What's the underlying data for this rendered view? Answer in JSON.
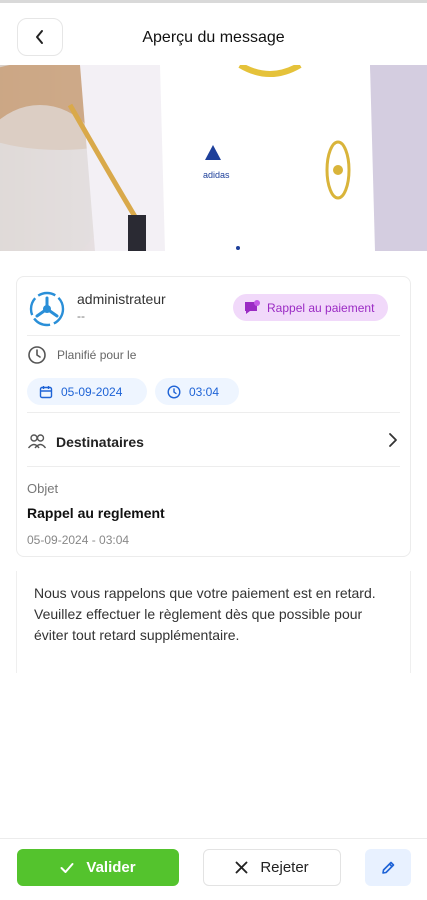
{
  "header": {
    "title": "Aperçu du message",
    "back_icon": "chevron-left-icon"
  },
  "hero": {
    "image_name": "sports-jersey-photo"
  },
  "sender": {
    "name": "administrateur",
    "sub": "--",
    "avatar_icon": "organization-logo-icon"
  },
  "badge": {
    "label": "Rappel au paiement",
    "icon": "chat-money-icon",
    "color": "#9b2bc4",
    "bg": "#f1d9fa"
  },
  "schedule": {
    "label": "Planifié pour le",
    "date": "05-09-2024",
    "time": "03:04",
    "chip_color": "#1e63d6"
  },
  "recipients": {
    "label": "Destinataires"
  },
  "subject": {
    "label": "Objet",
    "value": "Rappel au reglement",
    "datetime": "05-09-2024 - 03:04"
  },
  "body": {
    "text": "Nous vous rappelons que votre paiement est en retard. Veuillez effectuer le règlement dès que possible pour éviter tout retard supplémentaire."
  },
  "footer": {
    "validate_label": "Valider",
    "reject_label": "Rejeter",
    "validate_color": "#54c32d",
    "edit_icon": "pencil-icon"
  }
}
